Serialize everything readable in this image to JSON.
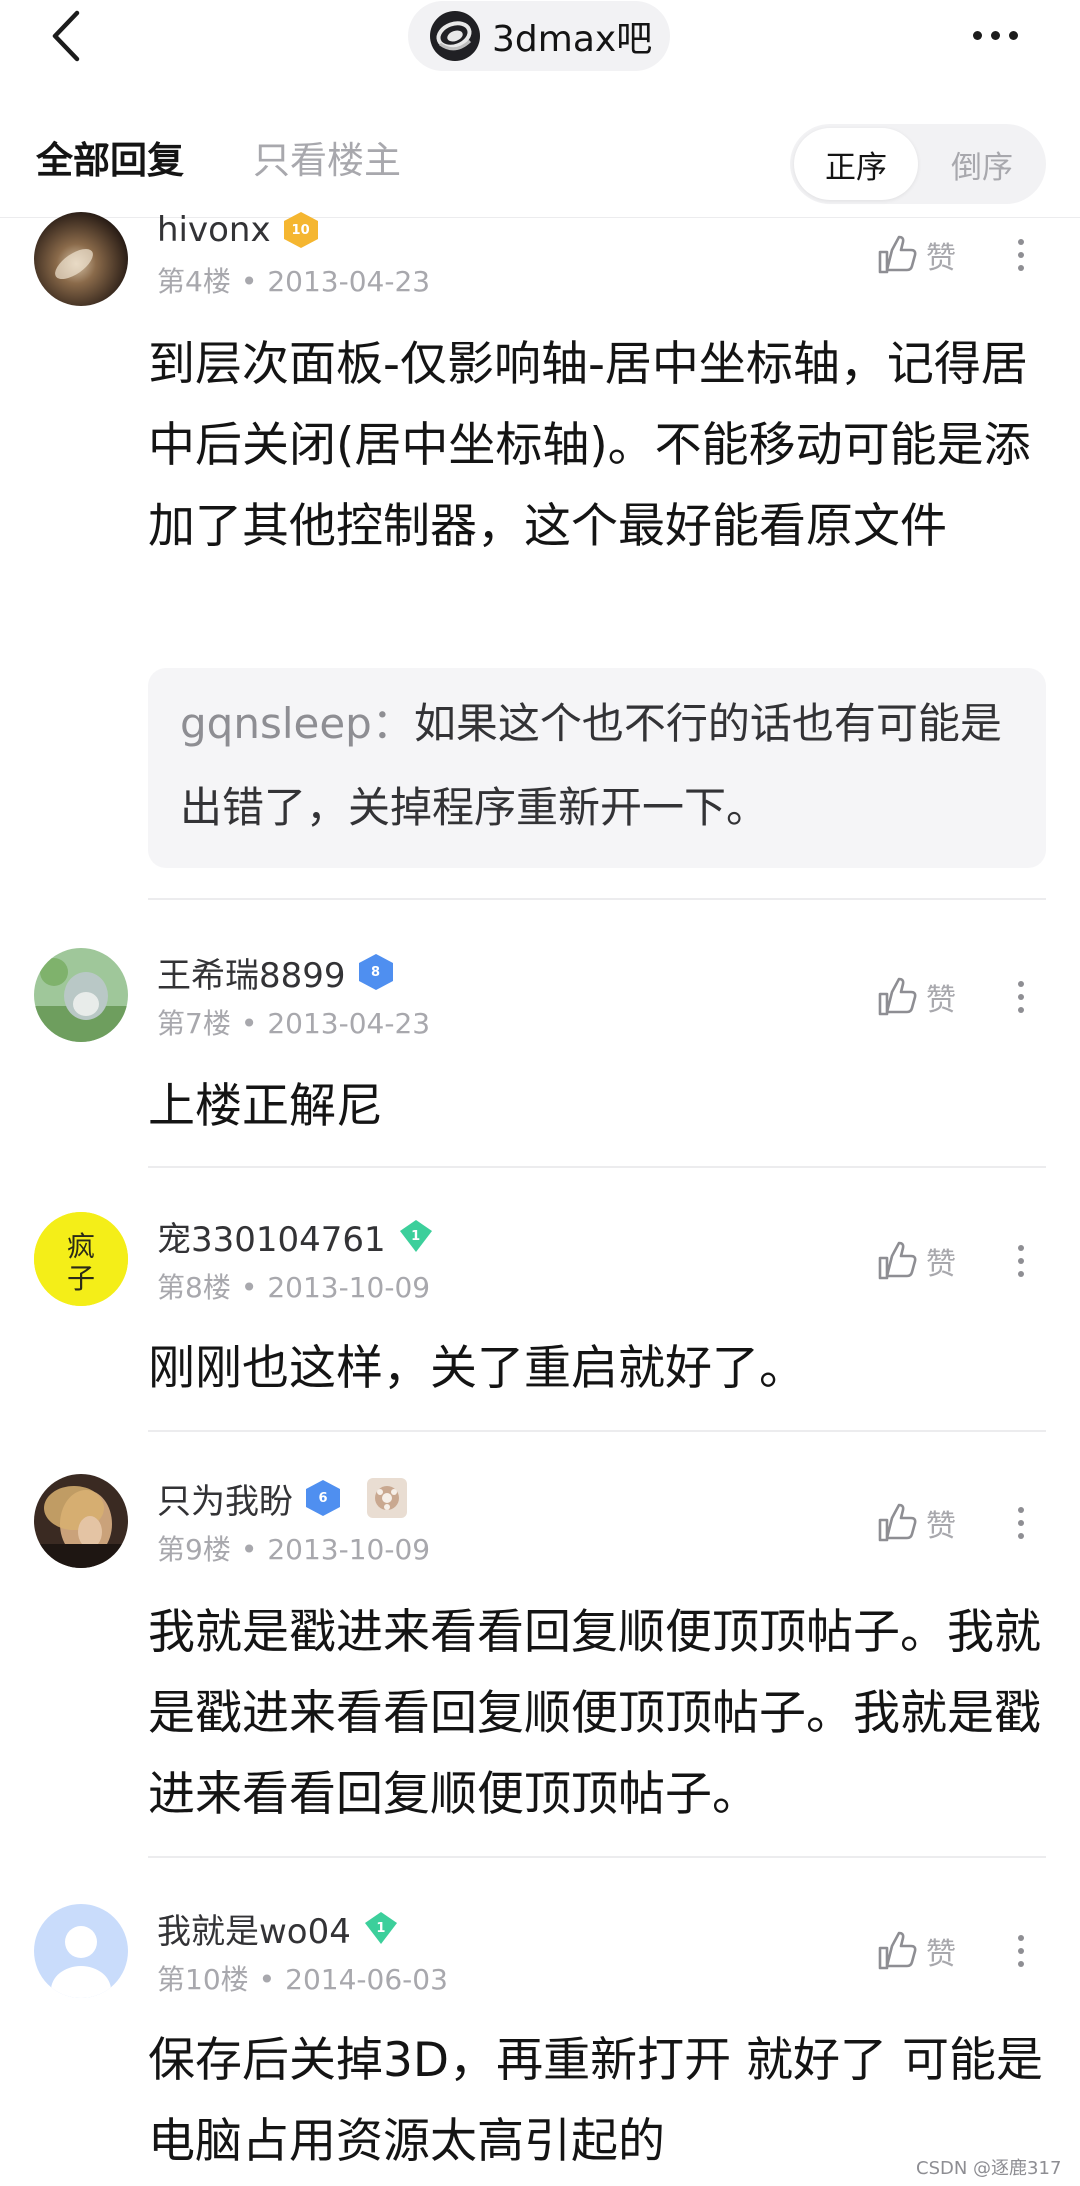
{
  "header": {
    "back_icon": "chevron-left-icon",
    "forum_name": "3dmax吧",
    "more_icon": "more-horizontal-icon"
  },
  "filter": {
    "tab_all": "全部回复",
    "tab_op_only": "只看楼主",
    "sort_asc": "正序",
    "sort_desc": "倒序",
    "active_tab": "全部回复",
    "active_sort": "正序"
  },
  "replies": [
    {
      "username": "hivonx",
      "level": "10",
      "level_color": "#f5b630",
      "floor": "第4楼",
      "date": "2013-04-23",
      "like_label": "赞",
      "content": "到层次面板-仅影响轴-居中坐标轴，记得居中后关闭(居中坐标轴)。不能移动可能是添加了其他控制器，这个最好能看原文件",
      "sub_reply": {
        "user": "gqnsleep：",
        "text": "如果这个也不行的话也有可能是出错了，关掉程序重新开一下。"
      }
    },
    {
      "username": "王希瑞8899",
      "level": "8",
      "level_color": "#4f8ff0",
      "floor": "第7楼",
      "date": "2013-04-23",
      "like_label": "赞",
      "content": "上楼正解尼"
    },
    {
      "username": "宠330104761",
      "level": "1",
      "level_color": "#3ccf9b",
      "floor": "第8楼",
      "date": "2013-10-09",
      "like_label": "赞",
      "content": "刚刚也这样，关了重启就好了。"
    },
    {
      "username": "只为我盼",
      "level": "6",
      "level_color": "#4f8ff0",
      "has_medal": true,
      "floor": "第9楼",
      "date": "2013-10-09",
      "like_label": "赞",
      "content": "我就是戳进来看看回复顺便顶顶帖子。我就是戳进来看看回复顺便顶顶帖子。我就是戳进来看看回复顺便顶顶帖子。"
    },
    {
      "username": "我就是wo04",
      "level": "1",
      "level_color": "#3ccf9b",
      "floor": "第10楼",
      "date": "2014-06-03",
      "like_label": "赞",
      "content": "保存后关掉3D，再重新打开 就好了 可能是电脑占用资源太高引起的"
    }
  ],
  "watermark": "CSDN @逐鹿317"
}
